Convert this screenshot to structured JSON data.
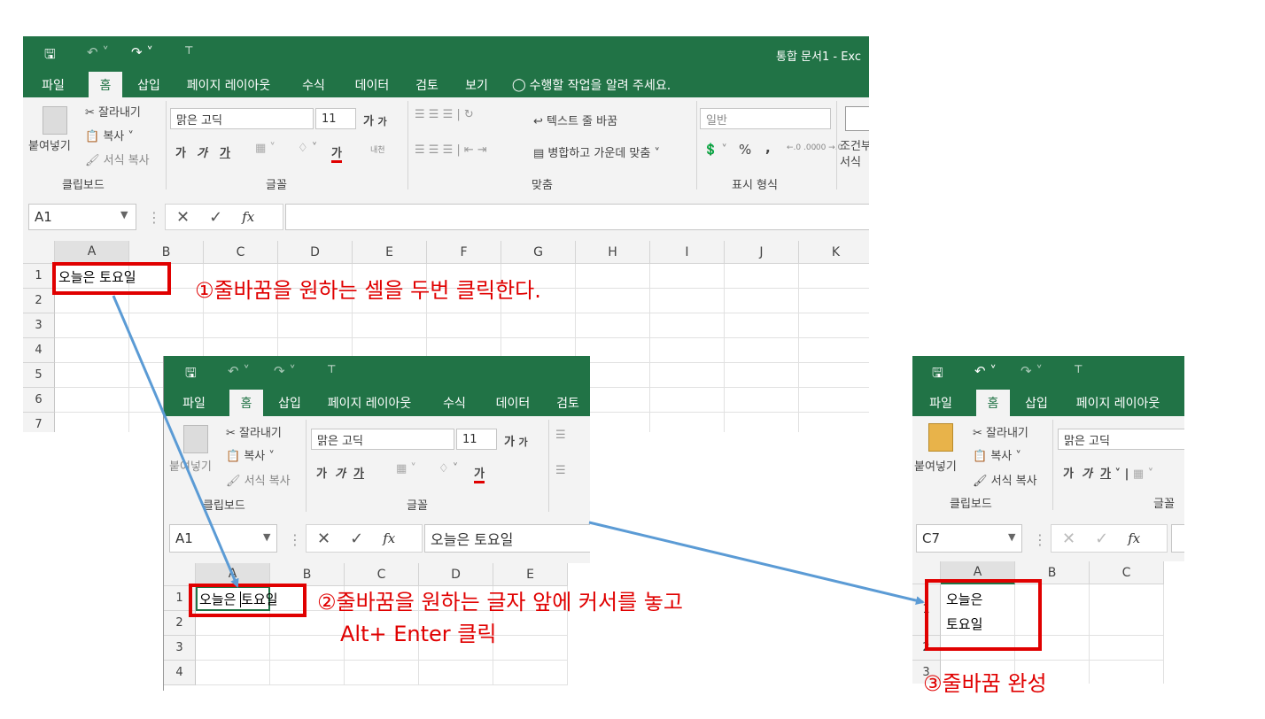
{
  "window1": {
    "title": "통합 문서1 - Exc",
    "tabs": [
      "파일",
      "홈",
      "삽입",
      "페이지 레이아웃",
      "수식",
      "데이터",
      "검토",
      "보기"
    ],
    "tell_me": "수행할 작업을 알려 주세요.",
    "clipboard": {
      "paste": "붙여넣기",
      "cut": "잘라내기",
      "copy": "복사",
      "format_painter": "서식 복사",
      "group": "클립보드"
    },
    "font": {
      "name": "맑은 고딕",
      "size": "11",
      "group": "글꼴",
      "bold": "가",
      "italic": "가",
      "underline": "가",
      "grow": "가",
      "shrink": "가",
      "color": "가",
      "phonetic": "내천"
    },
    "align": {
      "wrap": "텍스트 줄 바꿈",
      "merge": "병합하고 가운데 맞춤",
      "group": "맞춤"
    },
    "number": {
      "format": "일반",
      "group": "표시 형식",
      "percent": "%",
      "comma": ",",
      "inc": "←.0 .00",
      "dec": ".00 →.0"
    },
    "cond": {
      "line1": "조건부",
      "line2": "서식"
    },
    "name_box": "A1",
    "formula": "",
    "columns": [
      "A",
      "B",
      "C",
      "D",
      "E",
      "F",
      "G",
      "H",
      "I",
      "J",
      "K"
    ],
    "rows": [
      "1",
      "2",
      "3",
      "4",
      "5",
      "6",
      "7"
    ],
    "a1": "오늘은 토요일"
  },
  "window2": {
    "tabs": [
      "파일",
      "홈",
      "삽입",
      "페이지 레이아웃",
      "수식",
      "데이터",
      "검토"
    ],
    "clipboard": {
      "paste": "붙여넣기",
      "cut": "잘라내기",
      "copy": "복사",
      "format_painter": "서식 복사",
      "group": "클립보드"
    },
    "font": {
      "name": "맑은 고딕",
      "size": "11",
      "group": "글꼴"
    },
    "name_box": "A1",
    "formula": "오늘은 토요일",
    "columns": [
      "A",
      "B",
      "C",
      "D",
      "E"
    ],
    "rows": [
      "1",
      "2",
      "3",
      "4"
    ],
    "a1_part1": "오늘은 ",
    "a1_part2": "토요일"
  },
  "window3": {
    "tabs": [
      "파일",
      "홈",
      "삽입",
      "페이지 레이아웃"
    ],
    "clipboard": {
      "paste": "붙여넣기",
      "cut": "잘라내기",
      "copy": "복사",
      "format_painter": "서식 복사",
      "group": "클립보드"
    },
    "font": {
      "name": "맑은 고딕",
      "group": "글꼴"
    },
    "name_box": "C7",
    "columns": [
      "A",
      "B",
      "C"
    ],
    "rows": [
      "1",
      "2",
      "3"
    ],
    "a1_line1": "오늘은",
    "a1_line2": "토요일"
  },
  "annotations": {
    "step1": "①줄바꿈을 원하는 셀을 두번 클릭한다.",
    "step2_line1": "②줄바꿈을 원하는 글자 앞에 커서를 놓고",
    "step2_line2": "Alt+ Enter  클릭",
    "step3": "③줄바꿈 완성"
  },
  "colors": {
    "excel_green": "#217346",
    "annotation_red": "#e00000",
    "arrow_blue": "#5b9bd5"
  }
}
